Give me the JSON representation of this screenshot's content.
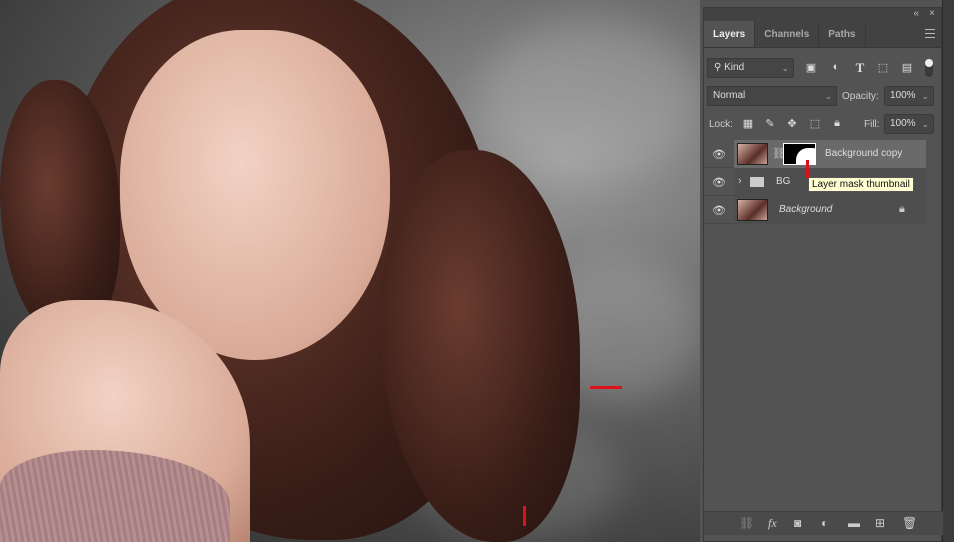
{
  "panel": {
    "collapse_icon": "«",
    "close_icon": "×",
    "tabs": [
      {
        "label": "Layers",
        "active": true
      },
      {
        "label": "Channels"
      },
      {
        "label": "Paths"
      }
    ],
    "filter": {
      "label": "Kind",
      "icons": [
        "image-filter-icon",
        "adjustment-filter-icon",
        "type-filter-icon",
        "shape-filter-icon",
        "smart-object-filter-icon"
      ]
    },
    "blend_mode": "Normal",
    "opacity_label": "Opacity:",
    "opacity_value": "100%",
    "lock_label": "Lock:",
    "fill_label": "Fill:",
    "fill_value": "100%",
    "layers": [
      {
        "name": "Background copy",
        "selected": true,
        "visible": true,
        "has_mask": true
      },
      {
        "name": "BG",
        "type": "group",
        "visible": true
      },
      {
        "name": "Background",
        "locked": true,
        "visible": true
      }
    ],
    "tooltip": "Layer mask thumbnail",
    "bottom_icons": [
      "link-layers",
      "fx",
      "add-mask",
      "adjustment-layer",
      "new-group",
      "new-layer",
      "delete-layer"
    ],
    "fx_label": "fx"
  },
  "colors": {
    "panel_bg": "#535353",
    "arrow": "#e0101a",
    "tooltip_bg": "#ffffd2"
  }
}
